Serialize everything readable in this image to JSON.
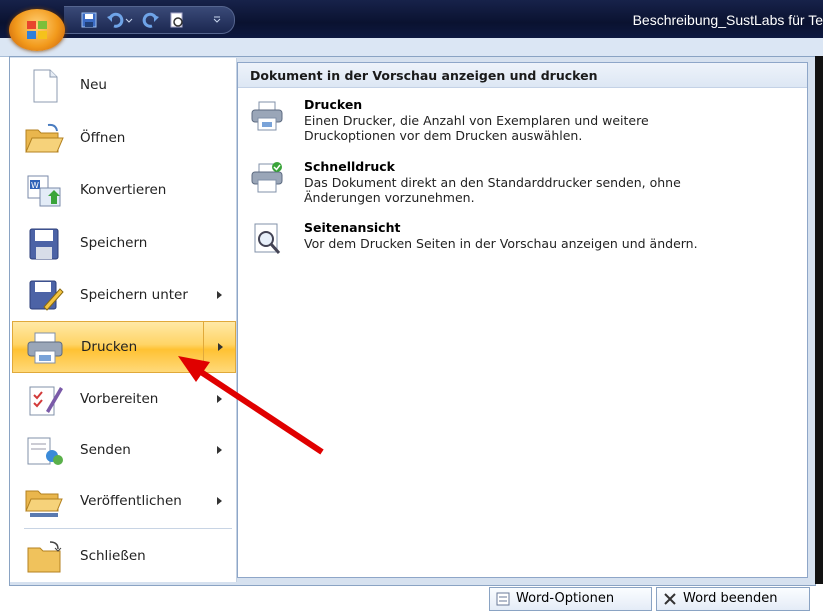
{
  "window": {
    "title": "Beschreibung_SustLabs für Te"
  },
  "menu": {
    "items": [
      {
        "label": "Neu",
        "icon": "new-document-icon",
        "submenu": false
      },
      {
        "label": "Öffnen",
        "icon": "open-folder-icon",
        "submenu": false
      },
      {
        "label": "Konvertieren",
        "icon": "convert-icon",
        "submenu": false
      },
      {
        "label": "Speichern",
        "icon": "save-icon",
        "submenu": false
      },
      {
        "label": "Speichern unter",
        "icon": "save-as-icon",
        "submenu": true
      },
      {
        "label": "Drucken",
        "icon": "printer-icon",
        "submenu": true,
        "active": true
      },
      {
        "label": "Vorbereiten",
        "icon": "prepare-icon",
        "submenu": true
      },
      {
        "label": "Senden",
        "icon": "send-icon",
        "submenu": true
      },
      {
        "label": "Veröffentlichen",
        "icon": "publish-icon",
        "submenu": true
      },
      {
        "label": "Schließen",
        "icon": "close-folder-icon",
        "submenu": false
      }
    ]
  },
  "panel": {
    "header": "Dokument in der Vorschau anzeigen und drucken",
    "items": [
      {
        "title": "Drucken",
        "desc_line1": "Einen Drucker, die Anzahl von Exemplaren und weitere",
        "desc_line2": "Druckoptionen vor dem Drucken auswählen.",
        "icon": "printer-icon"
      },
      {
        "title": "Schnelldruck",
        "desc_line1": "Das Dokument direkt an den Standarddrucker senden, ohne",
        "desc_line2": "Änderungen vorzunehmen.",
        "icon": "quick-print-icon"
      },
      {
        "title": "Seitenansicht",
        "desc_line1": "Vor dem Drucken Seiten in der Vorschau anzeigen und ändern.",
        "desc_line2": "",
        "icon": "print-preview-icon"
      }
    ]
  },
  "footer": {
    "options_label": "Word-Optionen",
    "exit_label": "Word beenden"
  },
  "colors": {
    "accent": "#ffc233",
    "annotation": "#e00000",
    "titlebar": "#0a1230"
  }
}
